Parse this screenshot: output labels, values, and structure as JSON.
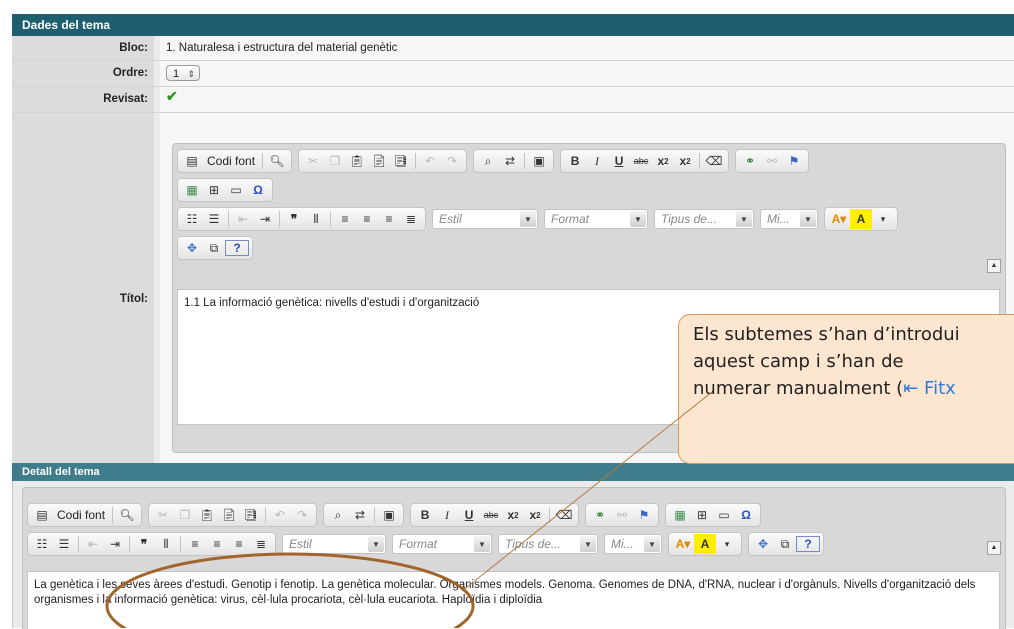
{
  "section_title": "Dades del tema",
  "fields": {
    "bloc_label": "Bloc:",
    "bloc_value": "1. Naturalesa i estructura del material genètic",
    "ordre_label": "Ordre:",
    "ordre_value": "1",
    "revisat_label": "Revisat:",
    "revisat_check": "✔",
    "titol_label": "Títol:"
  },
  "toolbar": {
    "source_label": "Codi font",
    "style_placeholder": "Estil",
    "format_placeholder": "Format",
    "font_placeholder": "Tipus de...",
    "size_placeholder": "Mi..."
  },
  "titol_content": "1.1 La informació genètica: nivells d'estudi i d'organització",
  "detail_section_title": "Detall del tema",
  "detail_content": "La genètica i les seves àrees d'estudi. Genotip i fenotip. La genètica molecular. Organismes models. Genoma. Genomes de DNA, d'RNA, nuclear i d'orgànuls. Nivells d'organització dels organismes i la informació genètica: virus, cèl·lula procariota, cèl·lula eucariota. Haploïdia i diploïdia",
  "callout": {
    "line1": "Els subtemes s’han d’introdui",
    "line2": "aquest camp i s’han de",
    "line3_text": "numerar manualment (",
    "line3_link": "⇤ Fitx"
  },
  "colors": {
    "header": "#1d5f6e",
    "subheader": "#3f7d8d",
    "callout_fill": "#fde6cf",
    "callout_border": "#d79b58",
    "annotation": "#a0652b"
  }
}
